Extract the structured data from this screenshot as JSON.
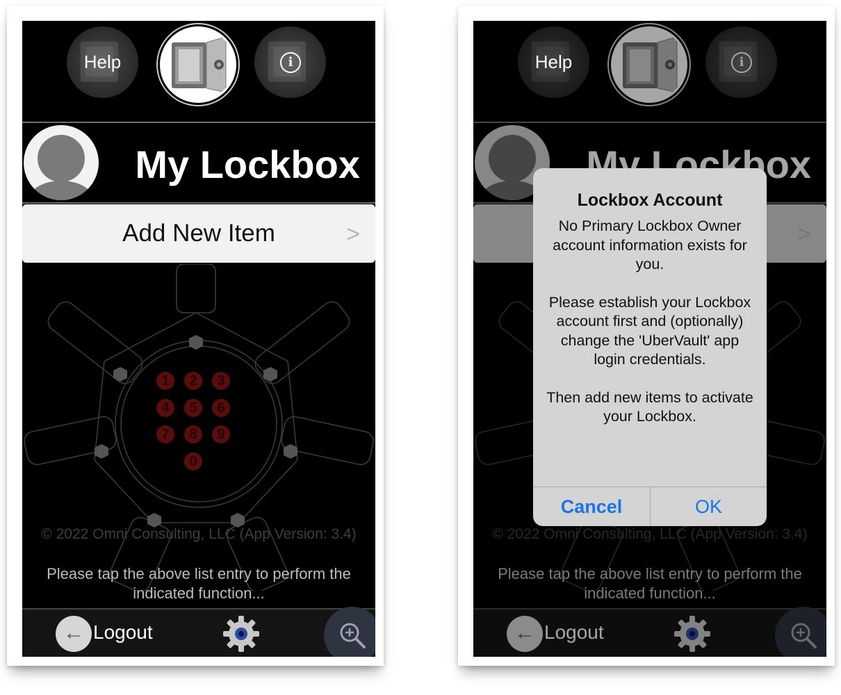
{
  "screens": [
    {
      "nav": {
        "help_label": "Help"
      },
      "header": {
        "title": "My Lockbox"
      },
      "list": {
        "item_label": "Add New Item",
        "chevron": ">"
      },
      "keypad": {
        "keys": [
          "1",
          "2",
          "3",
          "4",
          "5",
          "6",
          "7",
          "8",
          "9",
          "0"
        ]
      },
      "footer": {
        "copyright": "© 2022 Omni Consulting, LLC (App Version: 3.4)",
        "instruction": "Please tap the above list entry to perform the indicated function..."
      },
      "toolbar": {
        "logout_label": "Logout"
      }
    },
    {
      "nav": {
        "help_label": "Help"
      },
      "header": {
        "title": "My Lockbox"
      },
      "list": {
        "chevron": ">"
      },
      "footer": {
        "copyright": "© 2022 Omni Consulting, LLC (App Version: 3.4)",
        "instruction": "Please tap the above list entry to perform the indicated function..."
      },
      "toolbar": {
        "logout_label": "Logout"
      },
      "alert": {
        "title": "Lockbox Account",
        "paragraphs": [
          "No Primary Lockbox Owner account information exists for you.",
          "Please establish your Lockbox account first and (optionally) change the 'UberVault' app login credentials.",
          "Then add new items to activate your Lockbox."
        ],
        "cancel_label": "Cancel",
        "ok_label": "OK"
      }
    }
  ],
  "colors": {
    "background": "#000000",
    "alert_button": "#1a73e8",
    "keypad": "#5a0d0d"
  },
  "icons": [
    "safe-icon",
    "info-icon",
    "avatar-icon",
    "chevron-right-icon",
    "back-arrow-icon",
    "gear-icon",
    "zoom-icon"
  ]
}
